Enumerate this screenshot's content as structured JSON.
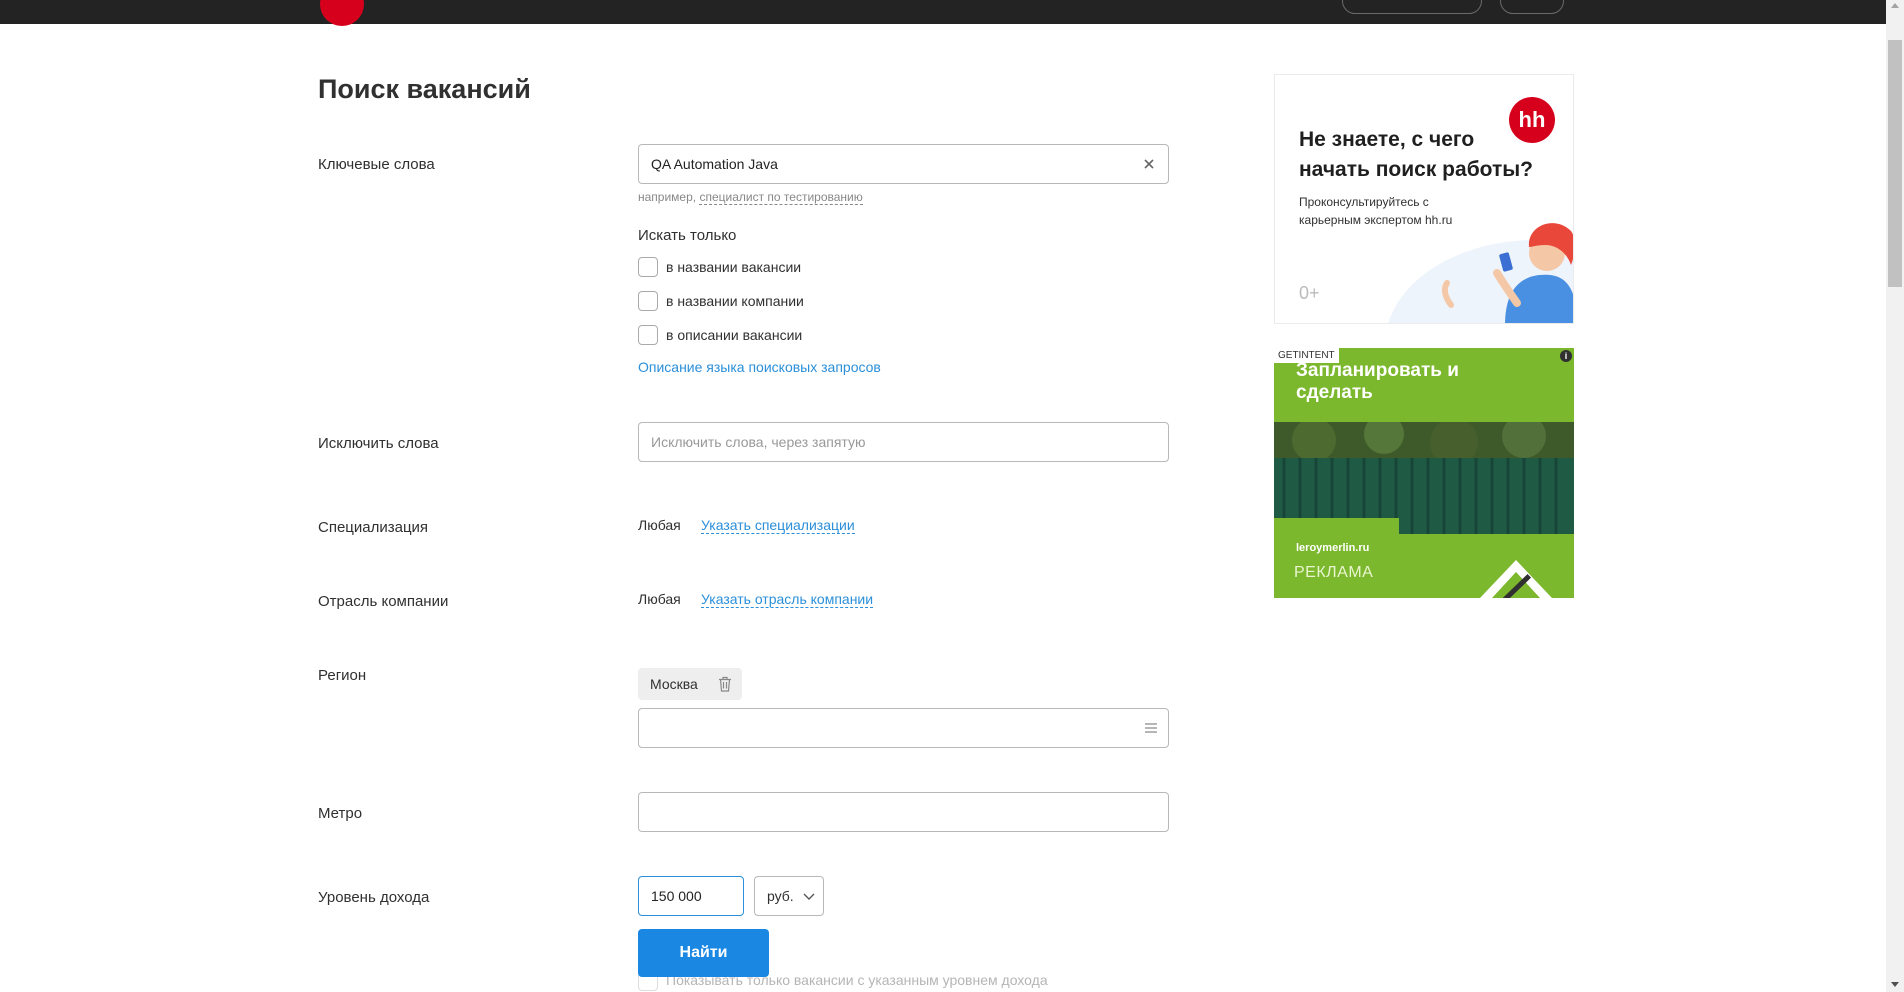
{
  "page": {
    "title": "Поиск вакансий"
  },
  "keywords": {
    "label": "Ключевые слова",
    "value": "QA Automation Java",
    "hint_prefix": "например,",
    "hint_example": "специалист по тестированию",
    "search_only_label": "Искать только",
    "options": [
      "в названии вакансии",
      "в названии компании",
      "в описании вакансии"
    ],
    "query_lang_link": "Описание языка поисковых запросов"
  },
  "exclude": {
    "label": "Исключить слова",
    "placeholder": "Исключить слова, через запятую",
    "value": ""
  },
  "specialization": {
    "label": "Специализация",
    "value": "Любая",
    "link": "Указать специализации"
  },
  "industry": {
    "label": "Отрасль компании",
    "value": "Любая",
    "link": "Указать отрасль компании"
  },
  "region": {
    "label": "Регион",
    "selected": "Москва",
    "value": ""
  },
  "metro": {
    "label": "Метро",
    "value": ""
  },
  "salary": {
    "label": "Уровень дохода",
    "value": "150 000",
    "currency": "руб.",
    "only_with_salary_label": "Показывать только вакансии с указанным уровнем дохода"
  },
  "submit": {
    "label": "Найти"
  },
  "ads": {
    "hh": {
      "logo_text": "hh",
      "title": "Не знаете, с чего начать поиск работы?",
      "text": "Проконсультируйтесь с карьерным экспертом hh.ru",
      "age": "0+"
    },
    "leroy": {
      "source": "GETINTENT",
      "info": "i",
      "title": "Запланировать и сделать",
      "domain": "leroymerlin.ru",
      "ad_label": "РЕКЛАМА"
    }
  },
  "colors": {
    "header_bg": "#232323",
    "brand_red": "#d6001c",
    "link_blue": "#2b8fd9",
    "button_blue": "#1a87e2",
    "ad_green": "#7cb82d"
  }
}
